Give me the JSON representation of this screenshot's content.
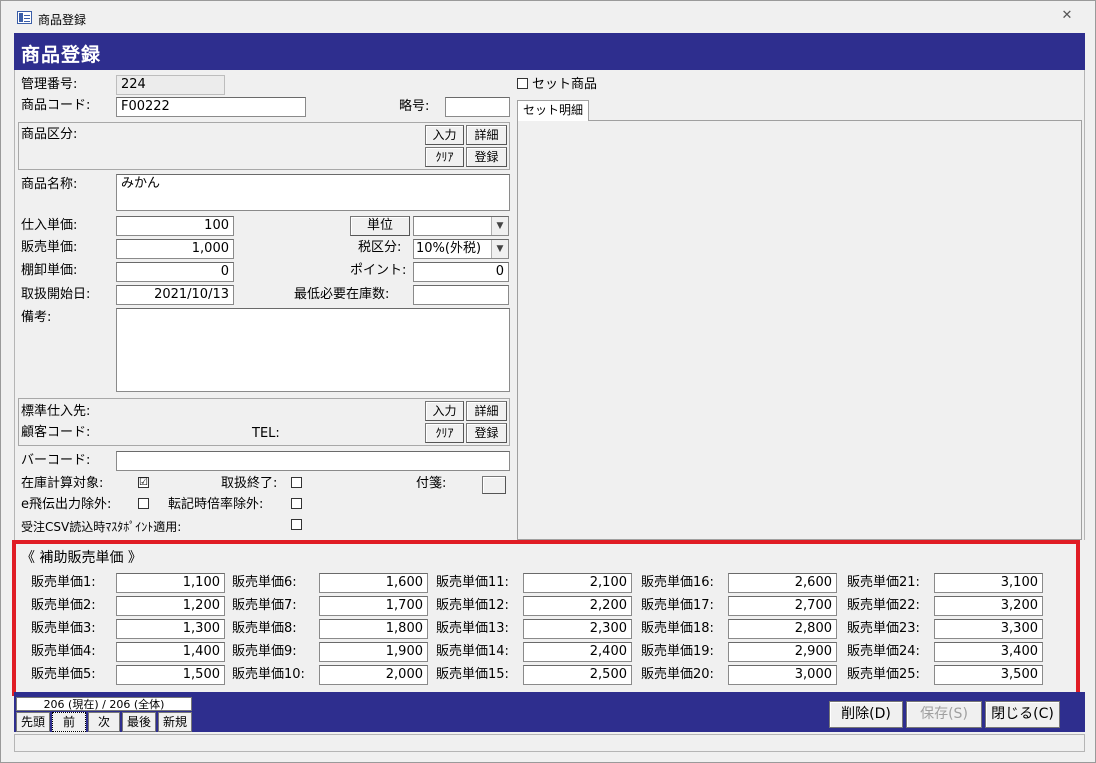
{
  "window": {
    "title": "商品登録",
    "close_glyph": "✕"
  },
  "header": {
    "title": "商品登録"
  },
  "fields": {
    "kanri_label": "管理番号:",
    "kanri_value": "224",
    "code_label": "商品コード:",
    "code_value": "F00222",
    "ryaku_label": "略号:",
    "ryaku_value": "",
    "kubun_label": "商品区分:",
    "name_label": "商品名称:",
    "name_value": "みかん",
    "shiire_label": "仕入単価:",
    "shiire_value": "100",
    "hanbai_label": "販売単価:",
    "hanbai_value": "1,000",
    "tanaoroshi_label": "棚卸単価:",
    "tanaoroshi_value": "0",
    "start_label": "取扱開始日:",
    "start_value": "2021/10/13",
    "biko_label": "備考:",
    "unit_button": "単位",
    "unit_value": "",
    "tax_label": "税区分:",
    "tax_value": "10%(外税)",
    "point_label": "ポイント:",
    "point_value": "0",
    "min_stock_label": "最低必要在庫数:",
    "min_stock_value": "",
    "supplier_label": "標準仕入先:",
    "customer_label": "顧客コード:",
    "tel_label": "TEL:",
    "barcode_label": "バーコード:",
    "barcode_value": "",
    "stock_calc_label": "在庫計算対象:",
    "stock_calc_checked": "☑",
    "end_label": "取扱終了:",
    "fusen_label": "付箋:",
    "ehiden_label": "e飛伝出力除外:",
    "tenki_label": "転記時倍率除外:",
    "csv_label": "受注CSV読込時ﾏｽﾀﾎﾟｲﾝﾄ適用:"
  },
  "buttons": {
    "input": "入力",
    "detail": "詳細",
    "clear": "ｸﾘｱ",
    "register": "登録"
  },
  "set": {
    "checkbox_label": "セット商品",
    "tab_label": "セット明細"
  },
  "sub_prices": {
    "heading": "《 補助販売単価 》",
    "columns": [
      [
        {
          "label": "販売単価1:",
          "value": "1,100"
        },
        {
          "label": "販売単価2:",
          "value": "1,200"
        },
        {
          "label": "販売単価3:",
          "value": "1,300"
        },
        {
          "label": "販売単価4:",
          "value": "1,400"
        },
        {
          "label": "販売単価5:",
          "value": "1,500"
        }
      ],
      [
        {
          "label": "販売単価6:",
          "value": "1,600"
        },
        {
          "label": "販売単価7:",
          "value": "1,700"
        },
        {
          "label": "販売単価8:",
          "value": "1,800"
        },
        {
          "label": "販売単価9:",
          "value": "1,900"
        },
        {
          "label": "販売単価10:",
          "value": "2,000"
        }
      ],
      [
        {
          "label": "販売単価11:",
          "value": "2,100"
        },
        {
          "label": "販売単価12:",
          "value": "2,200"
        },
        {
          "label": "販売単価13:",
          "value": "2,300"
        },
        {
          "label": "販売単価14:",
          "value": "2,400"
        },
        {
          "label": "販売単価15:",
          "value": "2,500"
        }
      ],
      [
        {
          "label": "販売単価16:",
          "value": "2,600"
        },
        {
          "label": "販売単価17:",
          "value": "2,700"
        },
        {
          "label": "販売単価18:",
          "value": "2,800"
        },
        {
          "label": "販売単価19:",
          "value": "2,900"
        },
        {
          "label": "販売単価20:",
          "value": "3,000"
        }
      ],
      [
        {
          "label": "販売単価21:",
          "value": "3,100"
        },
        {
          "label": "販売単価22:",
          "value": "3,200"
        },
        {
          "label": "販売単価23:",
          "value": "3,300"
        },
        {
          "label": "販売単価24:",
          "value": "3,400"
        },
        {
          "label": "販売単価25:",
          "value": "3,500"
        }
      ]
    ]
  },
  "nav": {
    "record_text": "206 (現在) / 206 (全体)",
    "first": "先頭",
    "prev": "前",
    "next": "次",
    "last": "最後",
    "new": "新規"
  },
  "footer": {
    "delete": "削除(D)",
    "save": "保存(S)",
    "close": "閉じる(C)"
  }
}
